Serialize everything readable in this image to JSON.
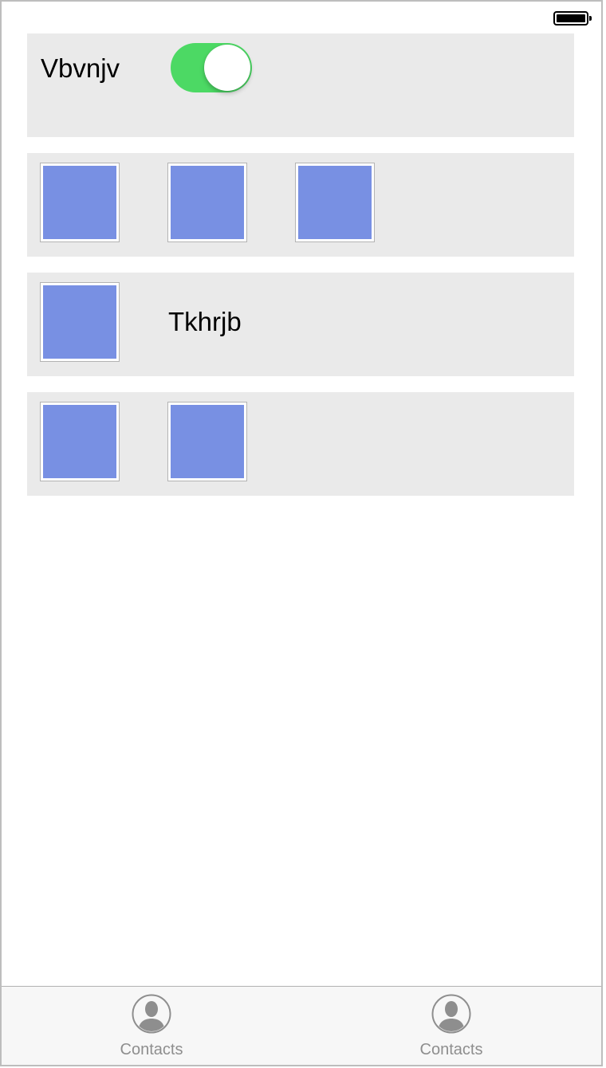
{
  "status_bar": {
    "battery_icon": "battery-full-icon"
  },
  "rows": [
    {
      "label": "Vbvnjv",
      "toggle": {
        "on": true,
        "color": "#4cd964"
      }
    },
    {
      "tiles": 3,
      "tile_color": "#7890e3"
    },
    {
      "tiles": 1,
      "label": "Tkhrjb",
      "tile_color": "#7890e3"
    },
    {
      "tiles": 2,
      "tile_color": "#7890e3"
    }
  ],
  "tab_bar": {
    "items": [
      {
        "label": "Contacts",
        "icon": "person-icon"
      },
      {
        "label": "Contacts",
        "icon": "person-icon"
      }
    ]
  }
}
